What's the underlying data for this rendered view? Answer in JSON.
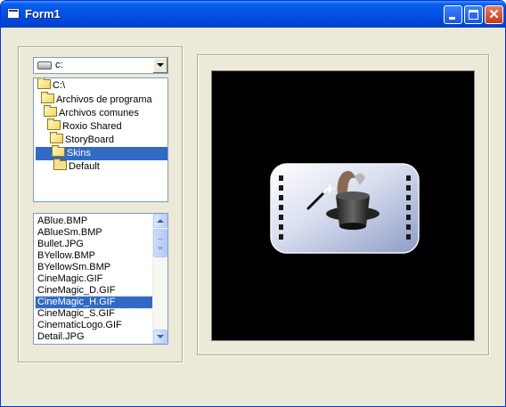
{
  "window": {
    "title": "Form1",
    "icons": {
      "app": "form-icon",
      "minimize": "minimize-icon",
      "maximize": "maximize-icon",
      "close": "close-icon"
    },
    "close_glyph": "✕"
  },
  "drive_combo": {
    "value": "c:",
    "icon": "drive-icon"
  },
  "dir_list": {
    "items": [
      {
        "label": "C:\\"
      },
      {
        "label": "Archivos de programa"
      },
      {
        "label": "Archivos comunes"
      },
      {
        "label": "Roxio Shared"
      },
      {
        "label": "StoryBoard"
      },
      {
        "label": "Skins",
        "selected": true
      },
      {
        "label": "Default"
      }
    ]
  },
  "file_list": {
    "items": [
      "ABlue.BMP",
      "ABlueSm.BMP",
      "Bullet.JPG",
      "BYellow.BMP",
      "BYellowSm.BMP",
      "CineMagic.GIF",
      "CineMagic_D.GIF",
      "CineMagic_H.GIF",
      "CineMagic_S.GIF",
      "CinematicLogo.GIF",
      "Detail.JPG"
    ],
    "selected_index": 7
  },
  "preview": {
    "image": "cinemagic-logo-icon",
    "description_icon": "magic-hat-film-icon"
  },
  "colors": {
    "selection": "#316ac5",
    "titlebar": "#0054e3",
    "background": "#ece9d8"
  }
}
